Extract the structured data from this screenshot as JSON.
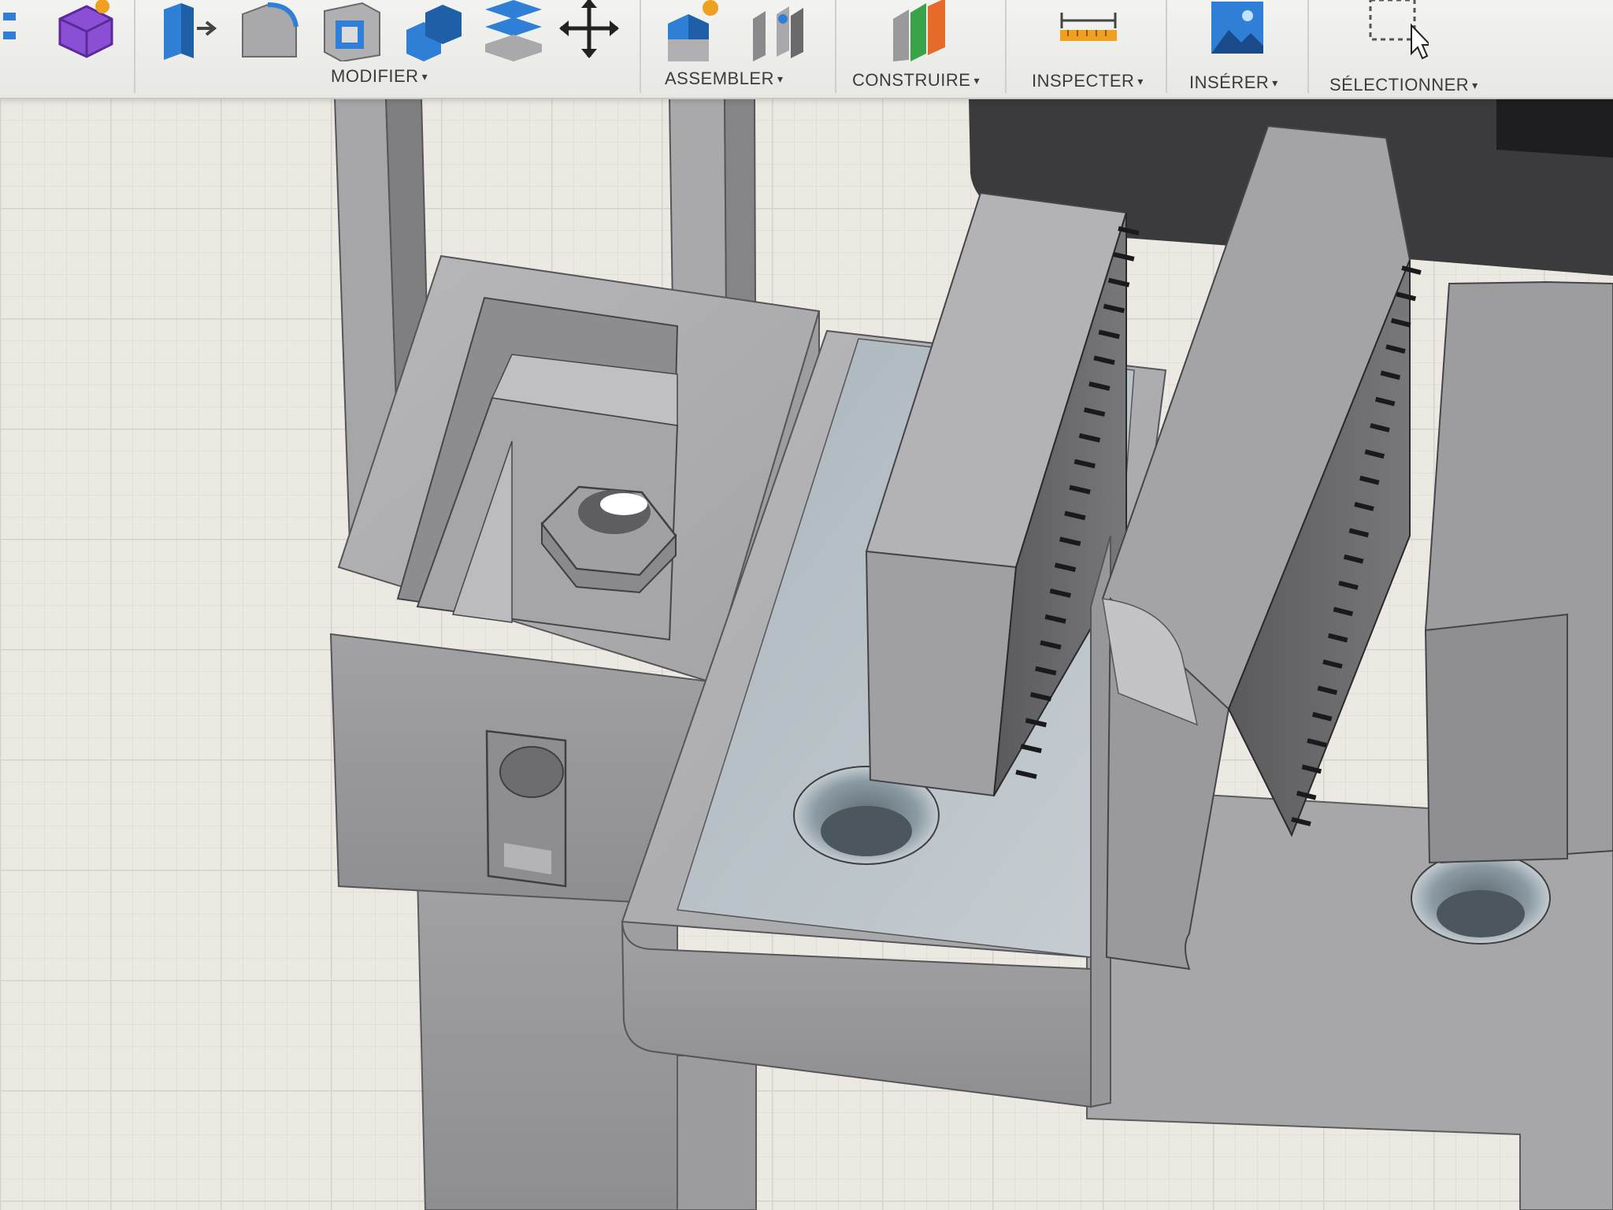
{
  "toolbar": {
    "groups": [
      {
        "label": "MODIFIER"
      },
      {
        "label": "ASSEMBLER"
      },
      {
        "label": "CONSTRUIRE"
      },
      {
        "label": "INSPECTER"
      },
      {
        "label": "INSÉRER"
      },
      {
        "label": "SÉLECTIONNER"
      }
    ],
    "dropdown_caret": "▾",
    "icons": {
      "modify": [
        "push-pull-icon",
        "fillet-icon",
        "shell-icon",
        "combine-icon",
        "offset-face-icon",
        "move-icon"
      ],
      "create": [
        "sketch-component-icon",
        "form-icon"
      ],
      "assemble": [
        "new-component-icon",
        "joint-icon"
      ],
      "construct": "plane-icon",
      "inspect": "measure-icon",
      "insert": "insert-image-icon",
      "select": "window-select-icon"
    }
  },
  "colors": {
    "toolbar_bg": "#ececea",
    "grid_bg": "#ebe9e2",
    "model_gray": "#9a9a9c",
    "accent_blue": "#2f7fd6",
    "accent_purple": "#7a3fc4",
    "accent_orange": "#f0a020"
  }
}
